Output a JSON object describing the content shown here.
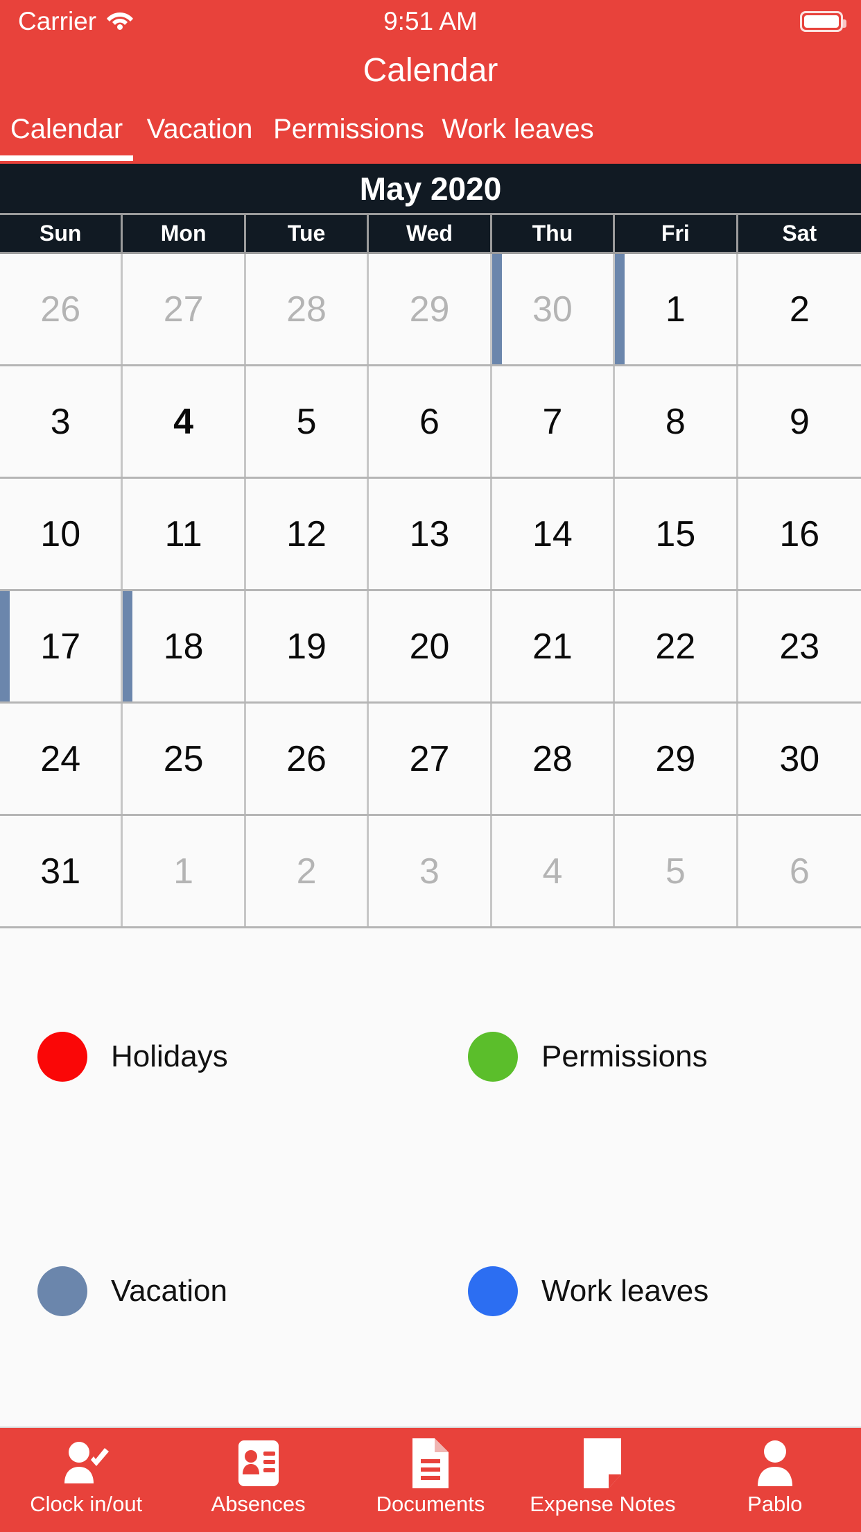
{
  "status_bar": {
    "carrier": "Carrier",
    "time": "9:51 AM",
    "wifi_icon": "wifi-icon",
    "battery_icon": "battery-icon"
  },
  "header": {
    "title": "Calendar",
    "background_color": "#E8423B",
    "tabs": [
      {
        "label": "Calendar",
        "active": true
      },
      {
        "label": "Vacation",
        "active": false
      },
      {
        "label": "Permissions",
        "active": false
      },
      {
        "label": "Work leaves",
        "active": false
      }
    ]
  },
  "calendar": {
    "month_label": "May 2020",
    "header_background": "#111A23",
    "weekday_headers": [
      "Sun",
      "Mon",
      "Tue",
      "Wed",
      "Thu",
      "Fri",
      "Sat"
    ],
    "weeks": [
      [
        {
          "day": "26",
          "muted": true,
          "bold": false,
          "vacation": false
        },
        {
          "day": "27",
          "muted": true,
          "bold": false,
          "vacation": false
        },
        {
          "day": "28",
          "muted": true,
          "bold": false,
          "vacation": false
        },
        {
          "day": "29",
          "muted": true,
          "bold": false,
          "vacation": false
        },
        {
          "day": "30",
          "muted": true,
          "bold": false,
          "vacation": true
        },
        {
          "day": "1",
          "muted": false,
          "bold": false,
          "vacation": true
        },
        {
          "day": "2",
          "muted": false,
          "bold": false,
          "vacation": false
        }
      ],
      [
        {
          "day": "3",
          "muted": false,
          "bold": false,
          "vacation": false
        },
        {
          "day": "4",
          "muted": false,
          "bold": true,
          "vacation": false
        },
        {
          "day": "5",
          "muted": false,
          "bold": false,
          "vacation": false
        },
        {
          "day": "6",
          "muted": false,
          "bold": false,
          "vacation": false
        },
        {
          "day": "7",
          "muted": false,
          "bold": false,
          "vacation": false
        },
        {
          "day": "8",
          "muted": false,
          "bold": false,
          "vacation": false
        },
        {
          "day": "9",
          "muted": false,
          "bold": false,
          "vacation": false
        }
      ],
      [
        {
          "day": "10",
          "muted": false,
          "bold": false,
          "vacation": false
        },
        {
          "day": "11",
          "muted": false,
          "bold": false,
          "vacation": false
        },
        {
          "day": "12",
          "muted": false,
          "bold": false,
          "vacation": false
        },
        {
          "day": "13",
          "muted": false,
          "bold": false,
          "vacation": false
        },
        {
          "day": "14",
          "muted": false,
          "bold": false,
          "vacation": false
        },
        {
          "day": "15",
          "muted": false,
          "bold": false,
          "vacation": false
        },
        {
          "day": "16",
          "muted": false,
          "bold": false,
          "vacation": false
        }
      ],
      [
        {
          "day": "17",
          "muted": false,
          "bold": false,
          "vacation": true
        },
        {
          "day": "18",
          "muted": false,
          "bold": false,
          "vacation": true
        },
        {
          "day": "19",
          "muted": false,
          "bold": false,
          "vacation": false
        },
        {
          "day": "20",
          "muted": false,
          "bold": false,
          "vacation": false
        },
        {
          "day": "21",
          "muted": false,
          "bold": false,
          "vacation": false
        },
        {
          "day": "22",
          "muted": false,
          "bold": false,
          "vacation": false
        },
        {
          "day": "23",
          "muted": false,
          "bold": false,
          "vacation": false
        }
      ],
      [
        {
          "day": "24",
          "muted": false,
          "bold": false,
          "vacation": false
        },
        {
          "day": "25",
          "muted": false,
          "bold": false,
          "vacation": false
        },
        {
          "day": "26",
          "muted": false,
          "bold": false,
          "vacation": false
        },
        {
          "day": "27",
          "muted": false,
          "bold": false,
          "vacation": false
        },
        {
          "day": "28",
          "muted": false,
          "bold": false,
          "vacation": false
        },
        {
          "day": "29",
          "muted": false,
          "bold": false,
          "vacation": false
        },
        {
          "day": "30",
          "muted": false,
          "bold": false,
          "vacation": false
        }
      ],
      [
        {
          "day": "31",
          "muted": false,
          "bold": false,
          "vacation": false
        },
        {
          "day": "1",
          "muted": true,
          "bold": false,
          "vacation": false
        },
        {
          "day": "2",
          "muted": true,
          "bold": false,
          "vacation": false
        },
        {
          "day": "3",
          "muted": true,
          "bold": false,
          "vacation": false
        },
        {
          "day": "4",
          "muted": true,
          "bold": false,
          "vacation": false
        },
        {
          "day": "5",
          "muted": true,
          "bold": false,
          "vacation": false
        },
        {
          "day": "6",
          "muted": true,
          "bold": false,
          "vacation": false
        }
      ]
    ],
    "vacation_bar_color": "#6B86AC"
  },
  "legend": [
    {
      "label": "Holidays",
      "color": "#FA0707"
    },
    {
      "label": "Permissions",
      "color": "#5BBE2B"
    },
    {
      "label": "Vacation",
      "color": "#6B86AC"
    },
    {
      "label": "Work leaves",
      "color": "#2C6EF2"
    }
  ],
  "bottom_nav": [
    {
      "label": "Clock in/out",
      "icon": "person-check-icon"
    },
    {
      "label": "Absences",
      "icon": "id-card-icon"
    },
    {
      "label": "Documents",
      "icon": "document-lines-icon"
    },
    {
      "label": "Expense Notes",
      "icon": "page-fold-icon"
    },
    {
      "label": "Pablo",
      "icon": "person-avatar-icon"
    }
  ]
}
